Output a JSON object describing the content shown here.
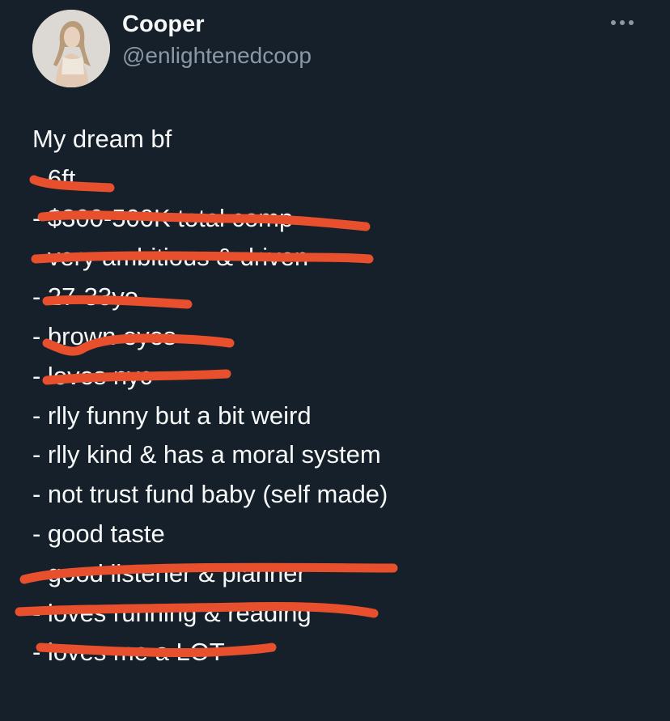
{
  "author": {
    "display_name": "Cooper",
    "handle": "@enlightenedcoop",
    "avatar_icon": "profile-photo"
  },
  "more_icon": "more-horizontal-icon",
  "tweet": {
    "lines": [
      "My dream bf",
      "- 6ft",
      "- $300-500K total comp",
      "- very ambitious & driven",
      "- 27-33yo",
      "- brown eyes",
      "- loves nyc",
      "- rlly funny but a bit weird",
      "- rlly kind & has a moral system",
      "- not trust fund baby (self made)",
      "- good taste",
      "- good listener & planner",
      "- loves running & reading",
      "- loves me a LOT"
    ]
  },
  "colors": {
    "background": "#15202b",
    "text": "#f7f9f9",
    "secondary_text": "#8b98a5",
    "scribble": "#e8502d"
  }
}
